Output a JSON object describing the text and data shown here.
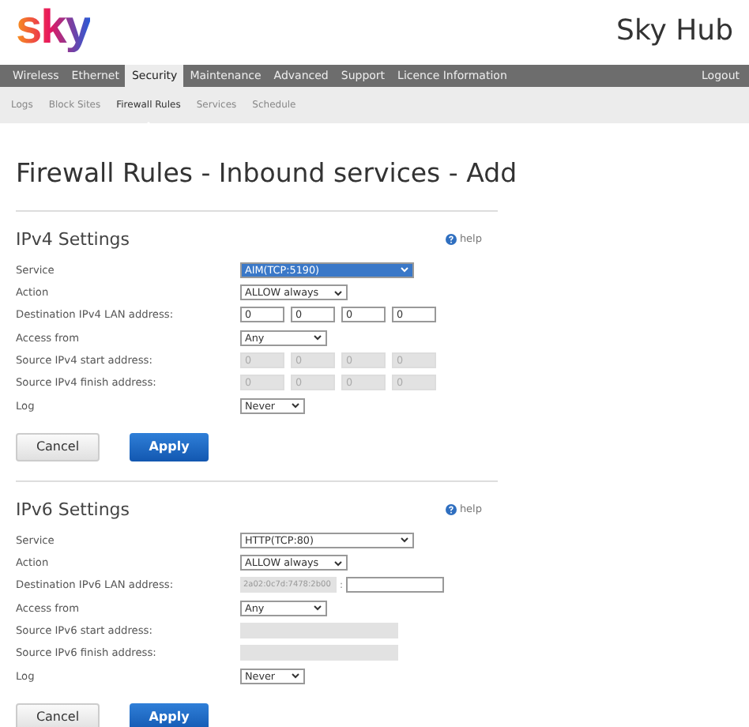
{
  "header": {
    "logo": "sky",
    "product": "Sky Hub"
  },
  "nav": {
    "items": [
      {
        "label": "Wireless",
        "selected": false
      },
      {
        "label": "Ethernet",
        "selected": false
      },
      {
        "label": "Security",
        "selected": true
      },
      {
        "label": "Maintenance",
        "selected": false
      },
      {
        "label": "Advanced",
        "selected": false
      },
      {
        "label": "Support",
        "selected": false
      },
      {
        "label": "Licence Information",
        "selected": false
      }
    ],
    "logout": "Logout"
  },
  "subnav": [
    {
      "label": "Logs",
      "selected": false
    },
    {
      "label": "Block Sites",
      "selected": false
    },
    {
      "label": "Firewall Rules",
      "selected": true
    },
    {
      "label": "Services",
      "selected": false
    },
    {
      "label": "Schedule",
      "selected": false
    }
  ],
  "title": "Firewall Rules - Inbound services - Add",
  "sections": [
    {
      "heading": "IPv4 Settings",
      "help": "help",
      "rows": [
        {
          "label": "Service",
          "kind": "select",
          "value": "AIM(TCP:5190)",
          "focused": true
        },
        {
          "label": "Action",
          "kind": "select",
          "value": "ALLOW always",
          "focused": false
        },
        {
          "label": "Destination IPv4 LAN address:",
          "kind": "ip4",
          "disabled": false,
          "octets": [
            "0",
            "0",
            "0",
            "0"
          ]
        },
        {
          "label": "Access from",
          "kind": "select",
          "value": "Any",
          "focused": false
        },
        {
          "label": "Source IPv4 start address:",
          "kind": "ip4",
          "disabled": true,
          "octets": [
            "0",
            "0",
            "0",
            "0"
          ]
        },
        {
          "label": "Source IPv4 finish address:",
          "kind": "ip4",
          "disabled": true,
          "octets": [
            "0",
            "0",
            "0",
            "0"
          ]
        },
        {
          "label": "Log",
          "kind": "select",
          "value": "Never",
          "focused": false
        }
      ],
      "buttons": {
        "cancel": "Cancel",
        "apply": "Apply"
      }
    },
    {
      "heading": "IPv6 Settings",
      "help": "help",
      "rows": [
        {
          "label": "Service",
          "kind": "select",
          "value": "HTTP(TCP:80)",
          "focused": false
        },
        {
          "label": "Action",
          "kind": "select",
          "value": "ALLOW always",
          "focused": false
        },
        {
          "label": "Destination IPv6 LAN address:",
          "kind": "ip6",
          "prefix": "2a02:0c7d:7478:2b00",
          "separator": ":"
        },
        {
          "label": "Access from",
          "kind": "select",
          "value": "Any",
          "focused": false
        },
        {
          "label": "Source IPv6 start address:",
          "kind": "wide"
        },
        {
          "label": "Source IPv6 finish address:",
          "kind": "wide"
        },
        {
          "label": "Log",
          "kind": "select",
          "value": "Never",
          "focused": false
        }
      ],
      "buttons": {
        "cancel": "Cancel",
        "apply": "Apply"
      }
    }
  ]
}
